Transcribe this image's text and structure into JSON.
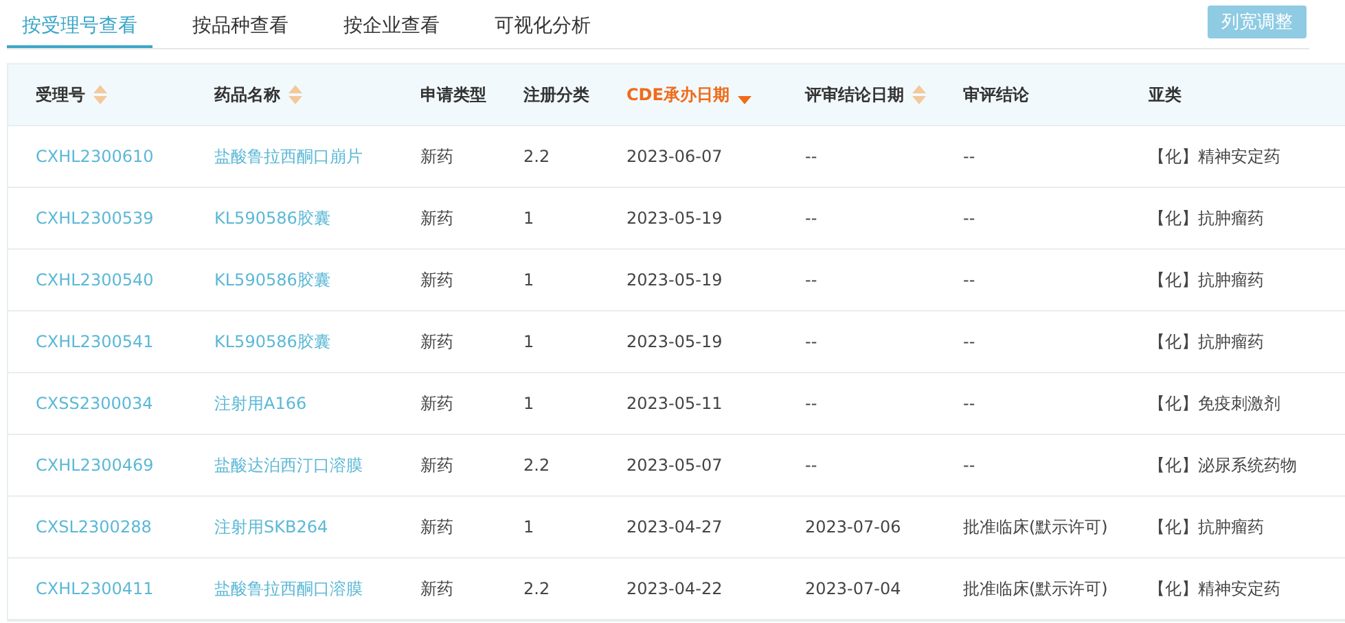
{
  "tabs": [
    {
      "label": "按受理号查看",
      "selected": true
    },
    {
      "label": "按品种查看",
      "selected": false
    },
    {
      "label": "按企业查看",
      "selected": false
    },
    {
      "label": "可视化分析",
      "selected": false
    }
  ],
  "toolbar": {
    "button": "列宽调整"
  },
  "table": {
    "columns": [
      {
        "label": "受理号",
        "sortable": true,
        "sorted": false,
        "kind": "link"
      },
      {
        "label": "药品名称",
        "sortable": true,
        "sorted": false,
        "kind": "link"
      },
      {
        "label": "申请类型",
        "sortable": false,
        "sorted": false,
        "kind": "text"
      },
      {
        "label": "注册分类",
        "sortable": false,
        "sorted": false,
        "kind": "text"
      },
      {
        "label": "CDE承办日期",
        "sortable": true,
        "sorted": true,
        "kind": "text"
      },
      {
        "label": "评审结论日期",
        "sortable": true,
        "sorted": false,
        "kind": "text"
      },
      {
        "label": "审评结论",
        "sortable": false,
        "sorted": false,
        "kind": "text"
      },
      {
        "label": "亚类",
        "sortable": false,
        "sorted": false,
        "kind": "text"
      }
    ],
    "rows": [
      [
        "CXHL2300610",
        "盐酸鲁拉西酮口崩片",
        "新药",
        "2.2",
        "2023-06-07",
        "--",
        "--",
        "【化】精神安定药"
      ],
      [
        "CXHL2300539",
        "KL590586胶囊",
        "新药",
        "1",
        "2023-05-19",
        "--",
        "--",
        "【化】抗肿瘤药"
      ],
      [
        "CXHL2300540",
        "KL590586胶囊",
        "新药",
        "1",
        "2023-05-19",
        "--",
        "--",
        "【化】抗肿瘤药"
      ],
      [
        "CXHL2300541",
        "KL590586胶囊",
        "新药",
        "1",
        "2023-05-19",
        "--",
        "--",
        "【化】抗肿瘤药"
      ],
      [
        "CXSS2300034",
        "注射用A166",
        "新药",
        "1",
        "2023-05-11",
        "--",
        "--",
        "【化】免疫刺激剂"
      ],
      [
        "CXHL2300469",
        "盐酸达泊西汀口溶膜",
        "新药",
        "2.2",
        "2023-05-07",
        "--",
        "--",
        "【化】泌尿系统药物"
      ],
      [
        "CXSL2300288",
        "注射用SKB264",
        "新药",
        "1",
        "2023-04-27",
        "2023-07-06",
        "批准临床(默示许可)",
        "【化】抗肿瘤药"
      ],
      [
        "CXHL2300411",
        "盐酸鲁拉西酮口溶膜",
        "新药",
        "2.2",
        "2023-04-22",
        "2023-07-04",
        "批准临床(默示许可)",
        "【化】精神安定药"
      ]
    ]
  }
}
